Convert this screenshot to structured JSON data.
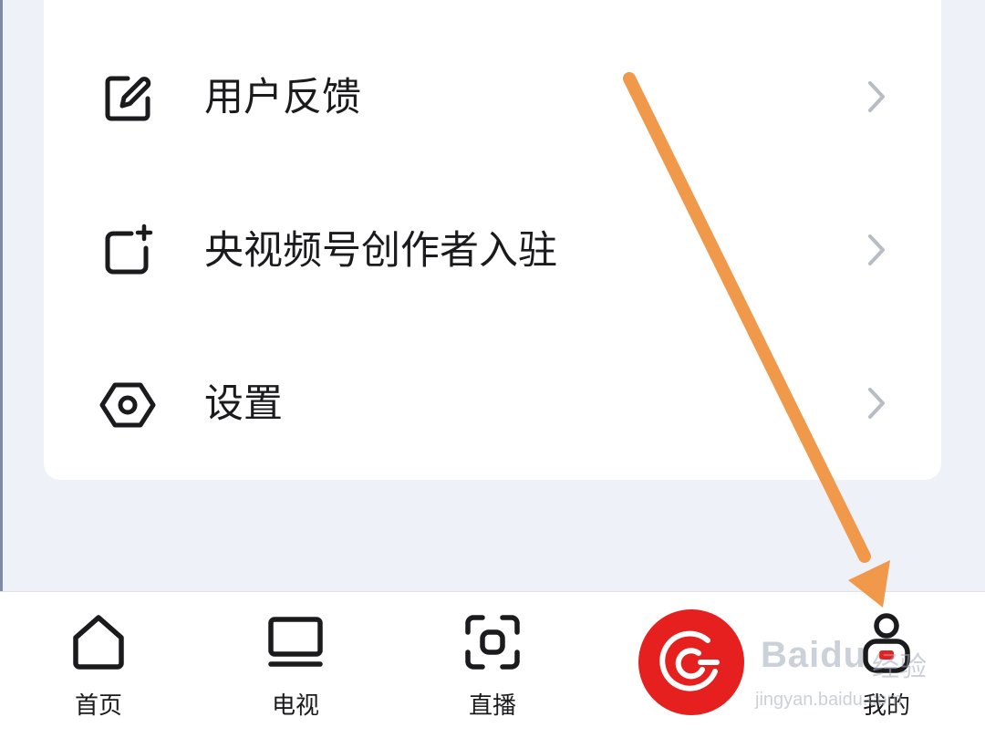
{
  "menu": {
    "items": [
      {
        "label": "用户反馈",
        "icon": "edit-icon"
      },
      {
        "label": "央视频号创作者入驻",
        "icon": "add-square-icon"
      },
      {
        "label": "设置",
        "icon": "settings-hexagon-icon"
      }
    ]
  },
  "tabbar": {
    "tabs": [
      {
        "label": "首页",
        "icon": "home-icon"
      },
      {
        "label": "电视",
        "icon": "tv-icon"
      },
      {
        "label": "直播",
        "icon": "live-icon"
      },
      {
        "label": "我的",
        "icon": "user-icon"
      }
    ],
    "center_button": {
      "icon": "cctv-logo-icon",
      "color": "#e61f1f"
    }
  },
  "annotation": {
    "color": "#f0994a"
  },
  "watermark": {
    "brand": "Baidu",
    "brand_cn": "经验",
    "url": "jingyan.baidu.com"
  }
}
